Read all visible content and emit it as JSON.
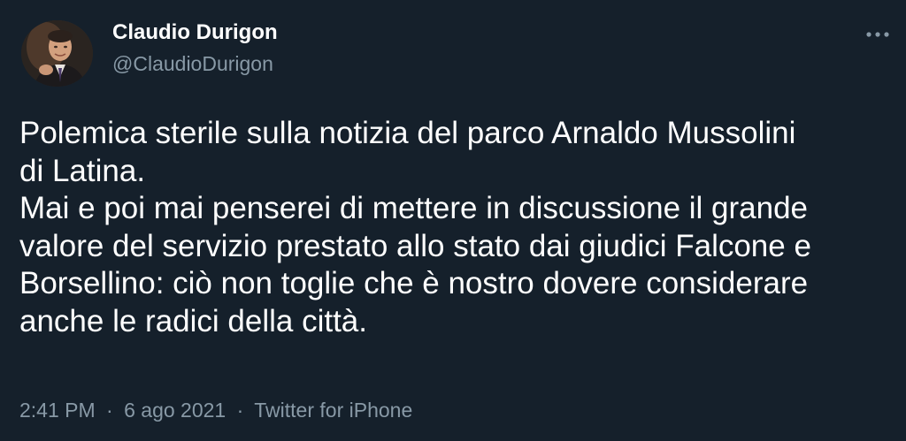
{
  "author": {
    "name": "Claudio Durigon",
    "handle": "@ClaudioDurigon"
  },
  "tweet": {
    "lines": [
      "Polemica sterile sulla notizia del parco Arnaldo Mussolini",
      "di Latina.",
      "Mai e poi mai penserei di mettere in discussione il grande",
      "valore del servizio prestato allo stato dai giudici Falcone e",
      "Borsellino: ciò non toglie che è nostro dovere considerare",
      "anche le radici della città."
    ]
  },
  "meta": {
    "time": "2:41 PM",
    "separator": "·",
    "date": "6 ago 2021",
    "source": "Twitter for iPhone"
  },
  "icons": {
    "more": "more-options-icon",
    "avatar": "avatar"
  },
  "colors": {
    "background": "#15202b",
    "text_primary": "#ffffff",
    "text_secondary": "#8899a6"
  }
}
